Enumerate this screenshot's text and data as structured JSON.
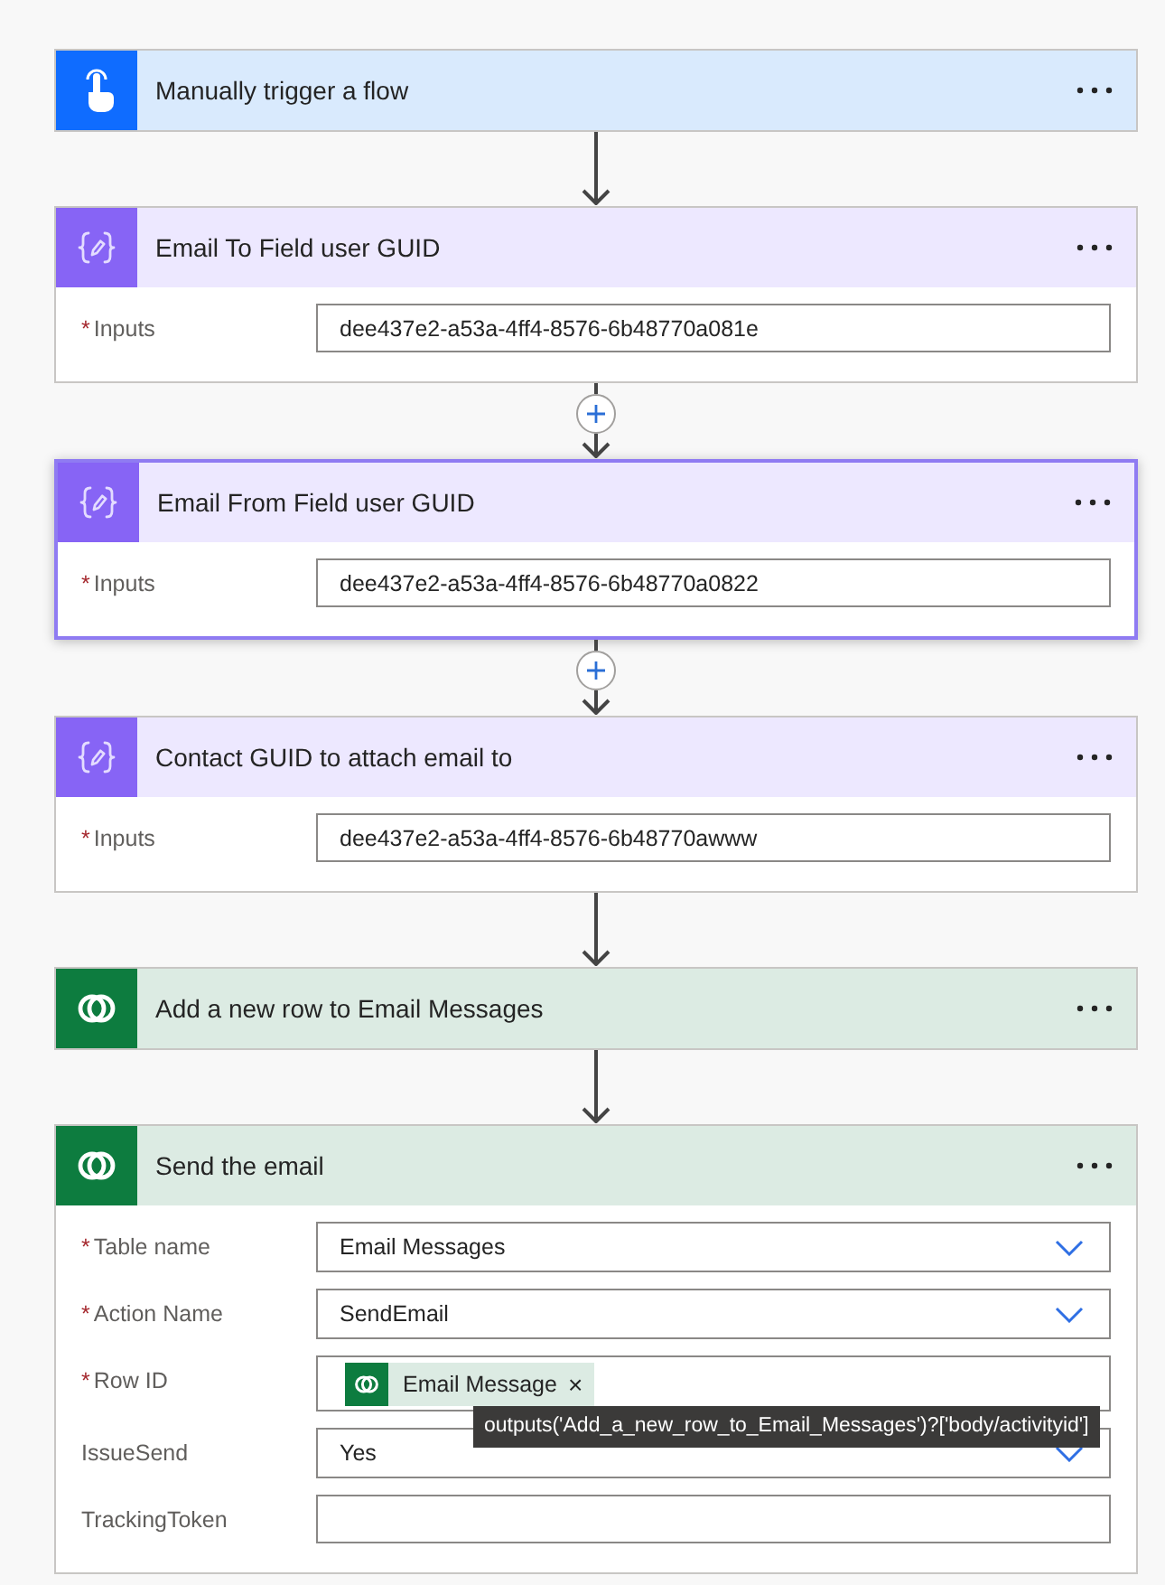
{
  "steps": [
    {
      "kind": "trigger",
      "title": "Manually trigger a flow",
      "selected": false
    },
    {
      "kind": "variable",
      "title": "Email To Field user GUID",
      "selected": false,
      "add_button_before": false,
      "fields": [
        {
          "label": "Inputs",
          "required_mark": "*",
          "kind": "text",
          "value": "dee437e2-a53a-4ff4-8576-6b48770a081e"
        }
      ]
    },
    {
      "kind": "variable",
      "title": "Email From Field user GUID",
      "selected": true,
      "add_button_before": true,
      "fields": [
        {
          "label": "Inputs",
          "required_mark": "*",
          "kind": "text",
          "value": "dee437e2-a53a-4ff4-8576-6b48770a0822"
        }
      ]
    },
    {
      "kind": "variable",
      "title": "Contact GUID to attach email to",
      "selected": false,
      "add_button_before": true,
      "fields": [
        {
          "label": "Inputs",
          "required_mark": "*",
          "kind": "text",
          "value": "dee437e2-a53a-4ff4-8576-6b48770awww"
        }
      ]
    },
    {
      "kind": "dataverse",
      "title": "Add a new row to Email Messages",
      "selected": false,
      "add_button_before": false
    },
    {
      "kind": "dataverse",
      "title": "Send the email",
      "selected": false,
      "add_button_before": false,
      "fields": [
        {
          "label": "Table name",
          "required_mark": "*",
          "kind": "dropdown",
          "value": "Email Messages"
        },
        {
          "label": "Action Name",
          "required_mark": "*",
          "kind": "dropdown",
          "value": "SendEmail"
        },
        {
          "label": "Row ID",
          "required_mark": "*",
          "kind": "token",
          "tokens": [
            {
              "label": "Email Message",
              "remove": "×"
            }
          ],
          "tooltip": "outputs('Add_a_new_row_to_Email_Messages')?['body/activityid']"
        },
        {
          "label": "IssueSend",
          "kind": "dropdown",
          "value": "Yes"
        },
        {
          "label": "TrackingToken",
          "kind": "text"
        }
      ]
    }
  ]
}
